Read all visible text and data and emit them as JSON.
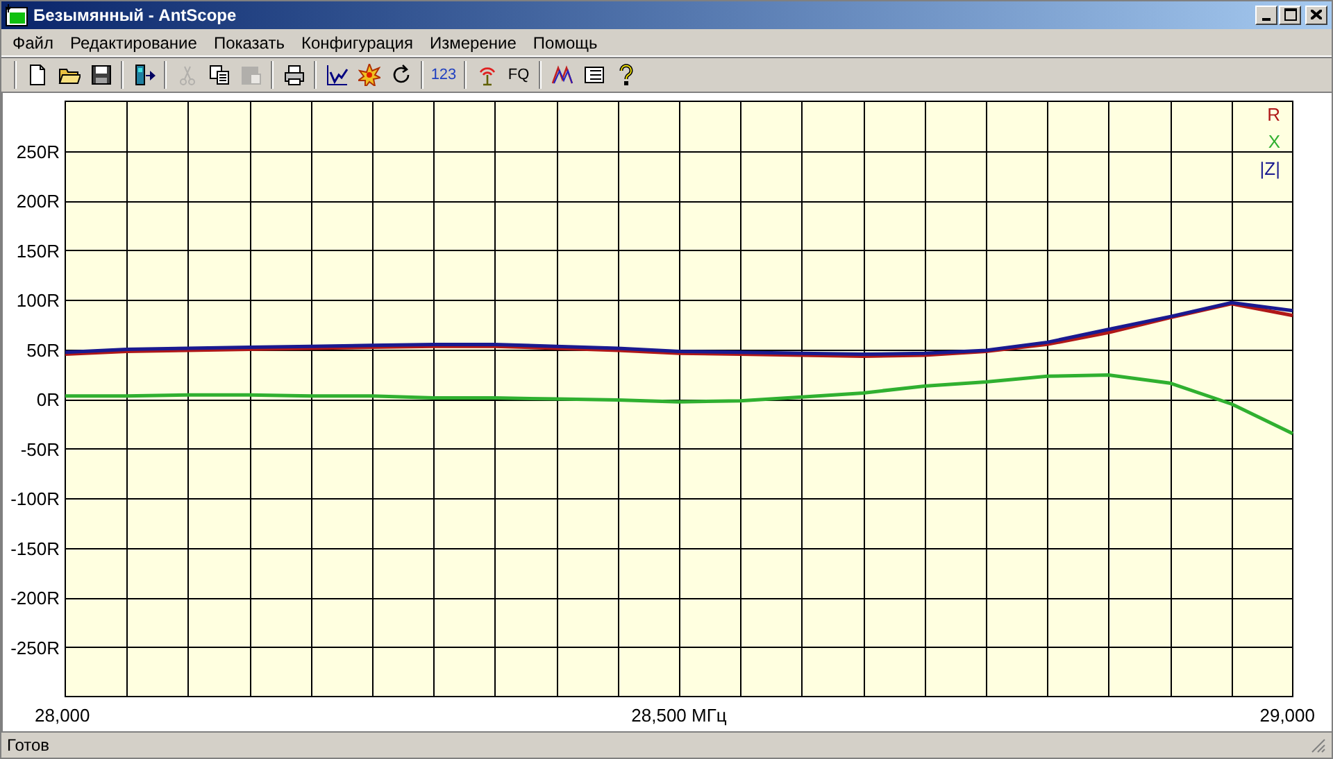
{
  "window": {
    "title": "Безымянный - AntScope"
  },
  "menu": [
    {
      "label": "Файл"
    },
    {
      "label": "Редактирование"
    },
    {
      "label": "Показать"
    },
    {
      "label": "Конфигурация"
    },
    {
      "label": "Измерение"
    },
    {
      "label": "Помощь"
    }
  ],
  "toolbar": [
    [
      {
        "disabled": false
      },
      {
        "disabled": false
      },
      {
        "disabled": false
      }
    ],
    [
      {
        "disabled": false
      }
    ],
    [
      {
        "disabled": true
      },
      {
        "disabled": false
      },
      {
        "disabled": true
      }
    ],
    [
      {
        "disabled": false
      }
    ],
    [
      {
        "disabled": false
      },
      {
        "disabled": false
      },
      {
        "disabled": false
      }
    ],
    [
      {
        "label": "123",
        "disabled": false
      }
    ],
    [
      {
        "disabled": false
      },
      {
        "label": "FQ",
        "disabled": false
      }
    ],
    [
      {
        "disabled": false
      },
      {
        "disabled": false
      },
      {
        "disabled": false
      }
    ]
  ],
  "chart_data": {
    "type": "line",
    "x": [
      28000,
      28050,
      28100,
      28150,
      28200,
      28250,
      28300,
      28350,
      28400,
      28450,
      28500,
      28550,
      28600,
      28650,
      28700,
      28750,
      28800,
      28850,
      28900,
      28950,
      29000
    ],
    "series": [
      {
        "name": "R",
        "color": "#b01818",
        "values": [
          45,
          48,
          49,
          50,
          51,
          52,
          53,
          53,
          51,
          49,
          46,
          45,
          44,
          43,
          44,
          48,
          55,
          67,
          82,
          96,
          84
        ]
      },
      {
        "name": "X",
        "color": "#30b030",
        "values": [
          3,
          3,
          4,
          4,
          3,
          3,
          1,
          1,
          0,
          -1,
          -3,
          -2,
          2,
          6,
          13,
          17,
          23,
          24,
          16,
          -5,
          -35
        ]
      },
      {
        "name": "|Z|",
        "color": "#1a1a90",
        "values": [
          47,
          50,
          51,
          52,
          53,
          54,
          55,
          55,
          53,
          51,
          48,
          47,
          46,
          45,
          46,
          49,
          57,
          70,
          83,
          97,
          89
        ]
      }
    ],
    "xlim": [
      28000,
      29000
    ],
    "ylim": [
      -300,
      300
    ],
    "grid": true,
    "xticks": [
      {
        "value": 28000,
        "label": "28,000"
      },
      {
        "value": 28500,
        "label": "28,500 МГц"
      },
      {
        "value": 29000,
        "label": "29,000"
      }
    ],
    "yticks": [
      {
        "value": 250,
        "label": "250R"
      },
      {
        "value": 200,
        "label": "200R"
      },
      {
        "value": 150,
        "label": "150R"
      },
      {
        "value": 100,
        "label": "100R"
      },
      {
        "value": 50,
        "label": "50R"
      },
      {
        "value": 0,
        "label": "0R"
      },
      {
        "value": -50,
        "label": "-50R"
      },
      {
        "value": -100,
        "label": "-100R"
      },
      {
        "value": -150,
        "label": "-150R"
      },
      {
        "value": -200,
        "label": "-200R"
      },
      {
        "value": -250,
        "label": "-250R"
      }
    ]
  },
  "status_bar": {
    "text": "Готов"
  }
}
